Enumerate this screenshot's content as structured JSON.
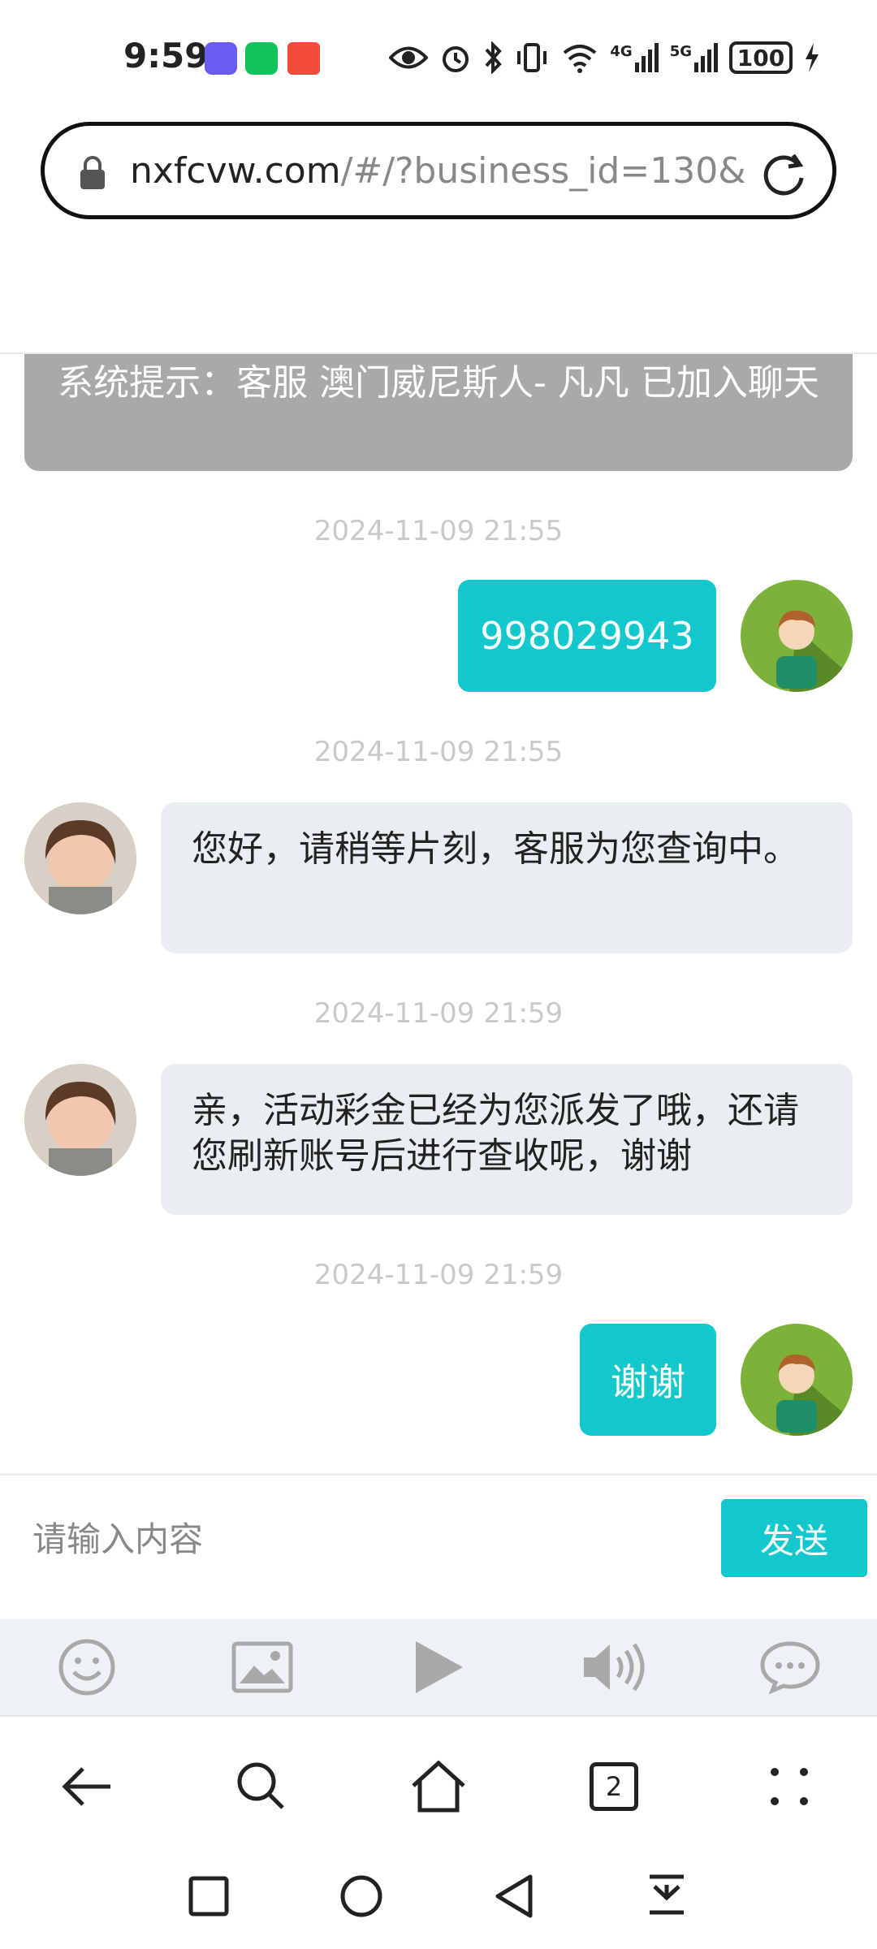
{
  "status_bar": {
    "time": "9:59",
    "battery": "100",
    "net1": "4G",
    "net2": "5G",
    "icons": [
      "eye-icon",
      "alarm-icon",
      "bluetooth-icon",
      "vibrate-icon",
      "wifi-icon",
      "signal-icon",
      "signal-icon",
      "charging-icon"
    ]
  },
  "browser": {
    "url_domain": "nxfcvw.com",
    "url_path": "/#/?business_id=130&",
    "tab_count": "2"
  },
  "chat": {
    "system_notice": "系统提示：客服 澳门威尼斯人- 凡凡 已加入聊天",
    "messages": [
      {
        "time": "2024-11-09 21:55",
        "side": "right",
        "text": "998029943"
      },
      {
        "time": "2024-11-09 21:55",
        "side": "left",
        "text": "您好，请稍等片刻，客服为您查询中。"
      },
      {
        "time": "2024-11-09 21:59",
        "side": "left",
        "text": "亲，活动彩金已经为您派发了哦，还请您刷新账号后进行查收呢，谢谢"
      },
      {
        "time": "2024-11-09 21:59",
        "side": "right",
        "text": "谢谢"
      }
    ]
  },
  "composer": {
    "placeholder": "请输入内容",
    "value": "",
    "send_label": "发送"
  },
  "toolbar": {
    "items": [
      "emoji-icon",
      "image-icon",
      "video-icon",
      "audio-icon",
      "chat-icon"
    ]
  },
  "colors": {
    "accent": "#13c8cd",
    "system_notice_bg": "#a9a9a9",
    "bubble_left_bg": "#e9eff0"
  }
}
